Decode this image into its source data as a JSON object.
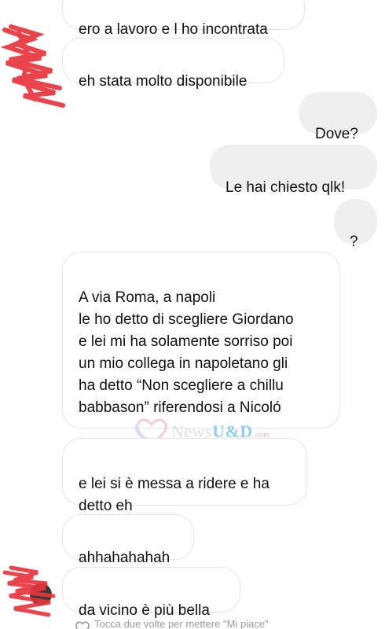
{
  "messages": [
    {
      "side": "incoming",
      "text": "ero a lavoro e l ho incontrata"
    },
    {
      "side": "incoming",
      "text": "eh stata molto disponibile"
    },
    {
      "side": "outgoing",
      "text": "Dove?"
    },
    {
      "side": "outgoing",
      "text": "Le hai chiesto qlk!"
    },
    {
      "side": "outgoing",
      "text": "?"
    },
    {
      "side": "incoming",
      "text": "A via Roma, a napoli\nle ho detto di scegliere Giordano\ne lei mi ha solamente sorriso poi\nun mio collega in napoletano gli\nha detto “Non scegliere a chillu\nbabbason” riferendosi a Nicoló",
      "emoji": "face-with-tears-of-joy-icon"
    },
    {
      "side": "incoming",
      "text": "e lei si è messa a ridere e ha\ndetto eh"
    },
    {
      "side": "incoming",
      "text": "ahhahahahah"
    },
    {
      "side": "incoming",
      "text": "da vicino è più bella"
    }
  ],
  "footer": {
    "like_hint": "Tocca due volte per mettere \"Mi piace\"",
    "icon": "heart-outline-icon"
  },
  "watermark": {
    "text_news": "News",
    "text_ud": "U&D",
    "text_com": ".com",
    "icon": "heart-logo-icon"
  },
  "colors": {
    "outgoing_bubble": "#efefef",
    "incoming_border": "#e4e4e4",
    "redaction": "#e8343c"
  }
}
